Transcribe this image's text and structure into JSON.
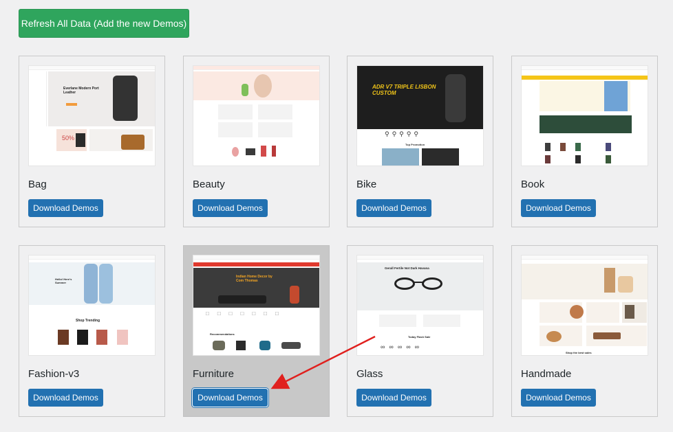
{
  "refresh_button": "Refresh All Data (Add the new Demos)",
  "demos": [
    {
      "title": "Bag",
      "button": "Download Demos"
    },
    {
      "title": "Beauty",
      "button": "Download Demos"
    },
    {
      "title": "Bike",
      "button": "Download Demos"
    },
    {
      "title": "Book",
      "button": "Download Demos"
    },
    {
      "title": "Fashion-v3",
      "button": "Download Demos"
    },
    {
      "title": "Furniture",
      "button": "Download Demos"
    },
    {
      "title": "Glass",
      "button": "Download Demos"
    },
    {
      "title": "Handmade",
      "button": "Download Demos"
    }
  ],
  "thumb_text": {
    "bag_hero": "Everlane Modern Port Leather",
    "bag_sale": "50%",
    "bike_banner": "ADR V7 TRIPLE LISBON CUSTOM",
    "bike_section": "Top Promotion",
    "fashion_hero": "Hello! Here's Summer",
    "fashion_section": "Shop Trending",
    "furniture_hero": "Indian Home Decor by Com Thomas",
    "furniture_section": "Recommendations",
    "glass_hero": "Gerall Fertile Not Dark Havana",
    "glass_section": "Today Flash Sale",
    "handmade_section": "Shop the best sales"
  },
  "colors": {
    "refresh_green": "#2fa55d",
    "button_blue": "#2271b1",
    "annotation_red": "#e0201e"
  }
}
